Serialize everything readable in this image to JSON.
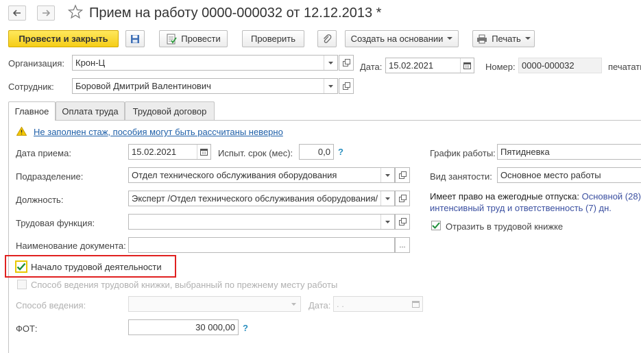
{
  "window": {
    "title": "Прием на работу 0000-000032 от 12.12.2013 *"
  },
  "toolbar": {
    "post_close": "Провести и закрыть",
    "post": "Провести",
    "check": "Проверить",
    "create_based": "Создать на основании",
    "print": "Печать"
  },
  "header": {
    "org_label": "Организация:",
    "org_value": "Крон-Ц",
    "date_label": "Дата:",
    "date_value": "15.02.2021",
    "number_label": "Номер:",
    "number_value": "0000-000032",
    "print_label": "печатать",
    "employee_label": "Сотрудник:",
    "employee_value": "Боровой Дмитрий Валентинович"
  },
  "tabs": [
    {
      "label": "Главное"
    },
    {
      "label": "Оплата труда"
    },
    {
      "label": "Трудовой договор"
    }
  ],
  "main": {
    "warning": "Не заполнен стаж, пособия могут быть рассчитаны неверно",
    "hire_date_label": "Дата приема:",
    "hire_date_value": "15.02.2021",
    "probation_label": "Испыт. срок (мес):",
    "probation_value": "0,0",
    "help": "?",
    "dept_label": "Подразделение:",
    "dept_value": "Отдел технического обслуживания оборудования",
    "position_label": "Должность:",
    "position_value": "Эксперт /Отдел технического обслуживания оборудования/",
    "labor_func_label": "Трудовая функция:",
    "labor_func_value": "",
    "doc_name_label": "Наименование документа:",
    "doc_name_value": "",
    "ellipsis": "...",
    "start_work_label": "Начало трудовой деятельности",
    "prev_method_label": "Способ ведения трудовой книжки, выбранный по прежнему месту работы",
    "method_label": "Способ ведения:",
    "method_date_label": "Дата:",
    "method_date_value": " .  .",
    "fot_label": "ФОТ:",
    "fot_value": "30 000,00",
    "schedule_label": "График работы:",
    "schedule_value": "Пятидневка",
    "employment_label": "Вид занятости:",
    "employment_value": "Основное место работы",
    "vacation_label": "Имеет право на ежегодные отпуска:",
    "vacation_main": "Основной (28)",
    "vacation_extra": "интенсивный труд и ответственность (7) дн.",
    "reflect_label": "Отразить в трудовой книжке"
  },
  "colors": {
    "primary_button": "#f5cd17",
    "link": "#1e5fa8",
    "highlight_box": "#e0201f",
    "checkmark": "#1f8f3a"
  }
}
